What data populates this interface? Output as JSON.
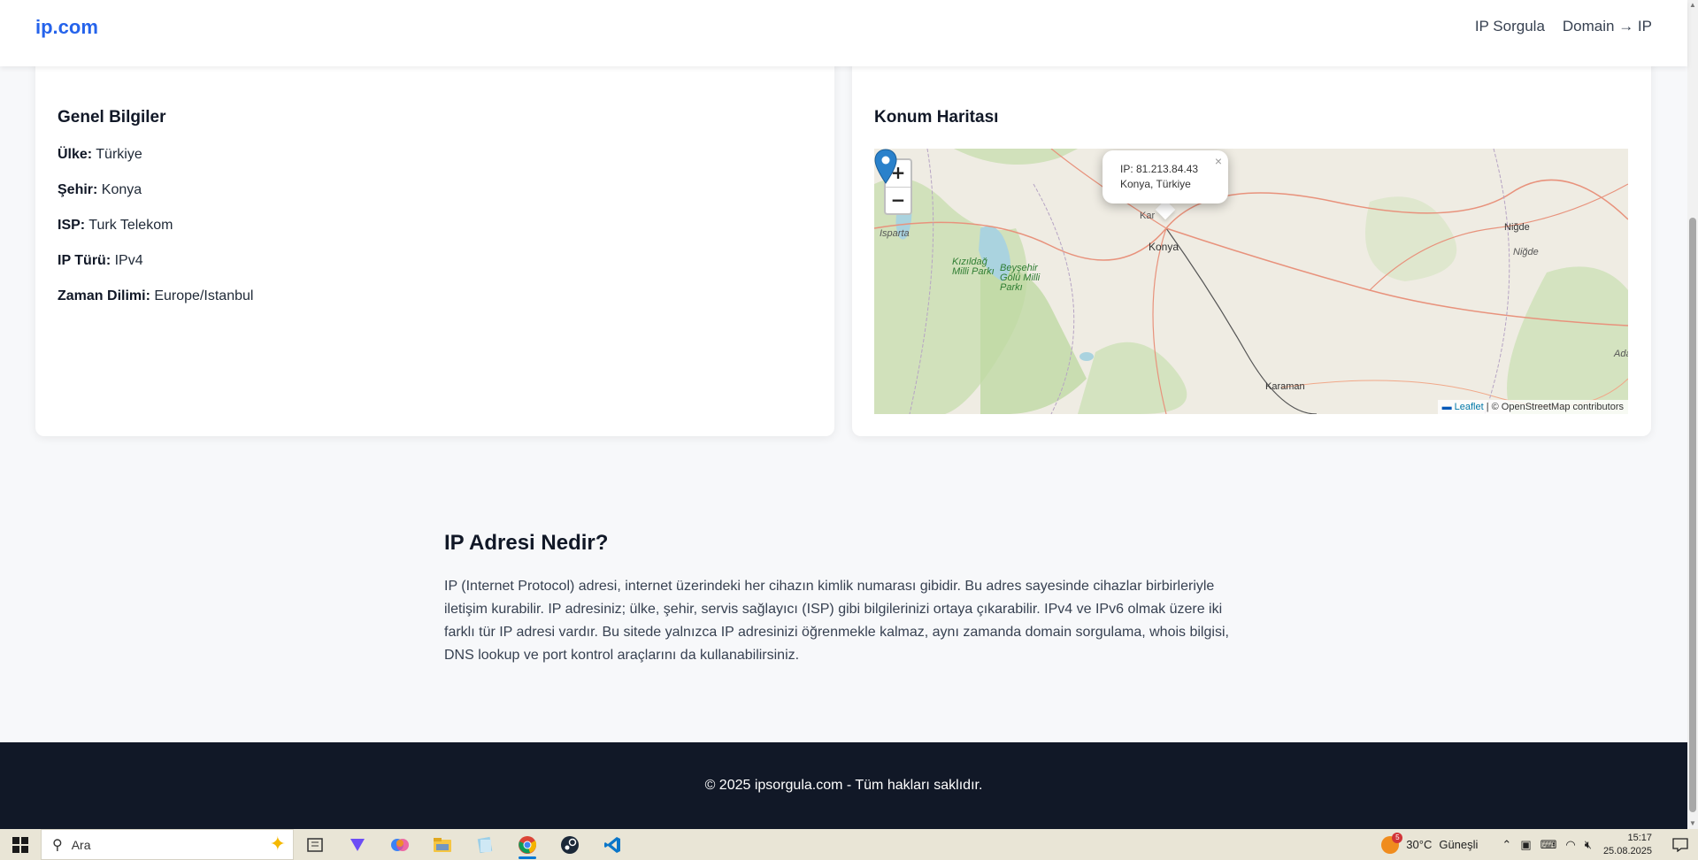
{
  "header": {
    "brand": "ip.com",
    "nav": [
      {
        "label": "IP Sorgula"
      },
      {
        "label": "Domain → IP"
      }
    ]
  },
  "general": {
    "title": "Genel Bilgiler",
    "rows": [
      {
        "label": "Ülke:",
        "value": "Türkiye"
      },
      {
        "label": "Şehir:",
        "value": "Konya"
      },
      {
        "label": "ISP:",
        "value": "Turk Telekom"
      },
      {
        "label": "IP Türü:",
        "value": "IPv4"
      },
      {
        "label": "Zaman Dilimi:",
        "value": "Europe/Istanbul"
      }
    ]
  },
  "map": {
    "title": "Konum Haritası",
    "zoom_in": "+",
    "zoom_out": "−",
    "popup_ip": "IP: 81.213.84.43",
    "popup_location": "Konya, Türkiye",
    "popup_close": "×",
    "attribution_leaflet": "Leaflet",
    "attribution_rest": " | © OpenStreetMap contributors",
    "labels": {
      "isparta": "Isparta",
      "kizildag": "Kızıldağ Milli Parkı",
      "beysehir": "Beyşehir Gölü Milli Parkı",
      "konya": "Konya",
      "nigde": "Niğde",
      "nigde2": "Niğde",
      "karaman": "Karaman",
      "ada": "Ada",
      "kar": "Kar"
    }
  },
  "about": {
    "title": "IP Adresi Nedir?",
    "text": "IP (Internet Protocol) adresi, internet üzerindeki her cihazın kimlik numarası gibidir. Bu adres sayesinde cihazlar birbirleriyle iletişim kurabilir. IP adresiniz; ülke, şehir, servis sağlayıcı (ISP) gibi bilgilerinizi ortaya çıkarabilir. IPv4 ve IPv6 olmak üzere iki farklı tür IP adresi vardır. Bu sitede yalnızca IP adresinizi öğrenmekle kalmaz, aynı zamanda domain sorgulama, whois bilgisi, DNS lookup ve port kontrol araçlarını da kullanabilirsiniz."
  },
  "footer": {
    "text": "© 2025 ipsorgula.com - Tüm hakları saklıdır."
  },
  "taskbar": {
    "search_placeholder": "Ara",
    "weather_temp": "30°C",
    "weather_desc": "Güneşli",
    "weather_badge": "5",
    "time": "15:17",
    "date": "25.08.2025"
  },
  "colors": {
    "brand": "#2563eb",
    "footer_bg": "#111827",
    "marker": "#2a81cb"
  }
}
